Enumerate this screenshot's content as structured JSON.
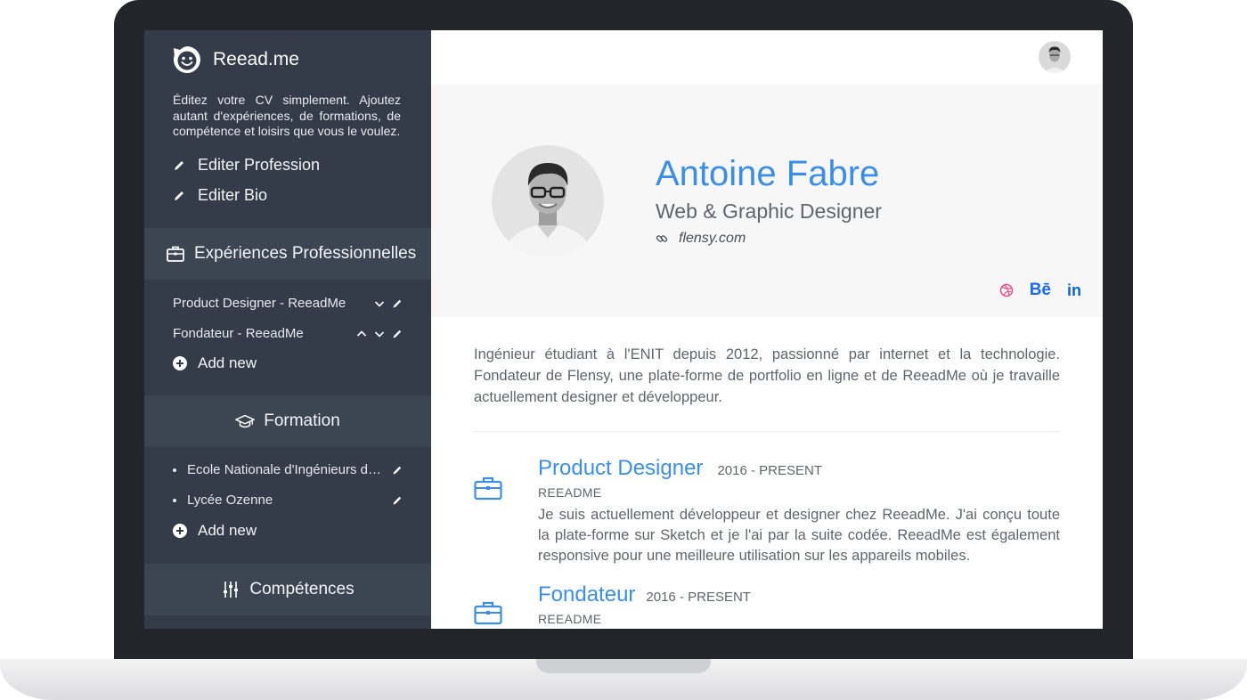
{
  "sidebar": {
    "brand": "Reead.me",
    "intro": "Éditez votre CV simplement. Ajoutez autant d'expériences, de formations, de compétence et loisirs que vous le voulez.",
    "edit_profession": "Editer Profession",
    "edit_bio": "Editer Bio",
    "sections": {
      "experience": {
        "title": "Expériences Professionnelles",
        "items": [
          {
            "label": "Product Designer - ReeadMe"
          },
          {
            "label": "Fondateur - ReeadMe"
          }
        ],
        "add": "Add new"
      },
      "formation": {
        "title": "Formation",
        "items": [
          {
            "label": "Ecole Nationale d'Ingénieurs de Tarbes"
          },
          {
            "label": "Lycée Ozenne"
          }
        ],
        "add": "Add new"
      },
      "competences": {
        "title": "Compétences"
      }
    }
  },
  "profile": {
    "name": "Antoine Fabre",
    "profession": "Web & Graphic Designer",
    "website": "flensy.com",
    "socials": {
      "behance": "Bē",
      "linkedin": "in"
    },
    "bio": "Ingénieur étudiant à l'ENIT depuis 2012, passionné par internet et la technologie. Fondateur de Flensy, une plate-forme de portfolio en ligne et de ReeadMe où je travaille actuellement designer et développeur."
  },
  "experiences": [
    {
      "title": "Product Designer",
      "dates": "2016 - PRESENT",
      "company": "REEADME",
      "description": "Je suis actuellement développeur et designer chez ReeadMe. J'ai conçu toute la plate-forme sur Sketch et je l'ai par la suite codée. ReeadMe est également responsive pour une meilleure utilisation sur les appareils mobiles."
    },
    {
      "title": "Fondateur",
      "dates": "2016 - PRESENT",
      "company": "REEADME"
    }
  ],
  "colors": {
    "accent": "#3b8ee8",
    "sidebar": "#333c48",
    "sidebar_header": "#3c4653",
    "hero_bg": "#f7f7f8"
  }
}
